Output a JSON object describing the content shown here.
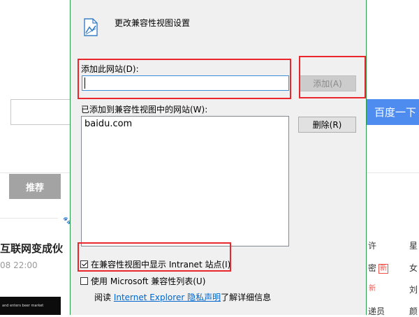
{
  "background_page": {
    "search_button_label": "百度一下",
    "tab_label": "推荐",
    "news_title": "互联网变成伙",
    "news_time": "08 22:00",
    "thumbnail_text": "and enters beer market",
    "hot_list": [
      {
        "text": "许",
        "badge": ""
      },
      {
        "text": "星",
        "badge": ""
      },
      {
        "text": "密",
        "badge": "新"
      },
      {
        "text": "女",
        "badge": ""
      },
      {
        "text": "",
        "badge": "新"
      },
      {
        "text": "刘",
        "badge": ""
      },
      {
        "text": "递员",
        "badge": ""
      },
      {
        "text": "颜",
        "badge": ""
      }
    ]
  },
  "dialog": {
    "title": "更改兼容性视图设置",
    "add_site_label": "添加此网站(D):",
    "add_site_value": "",
    "add_button_label": "添加(A)",
    "added_sites_label": "已添加到兼容性视图中的网站(W):",
    "added_sites": [
      "baidu.com"
    ],
    "remove_button_label": "删除(R)",
    "intranet_checkbox": {
      "label": "在兼容性视图中显示 Intranet 站点(I)",
      "checked": true
    },
    "ms_list_checkbox": {
      "label": "使用 Microsoft 兼容性列表(U)",
      "checked": false
    },
    "privacy": {
      "prefix": "阅读 ",
      "link": "Internet Explorer 隐私声明",
      "suffix": "了解详细信息"
    }
  },
  "colors": {
    "highlight": "#e8262b",
    "accent_blue": "#4e8cf0",
    "window_border": "#2c9b4e",
    "link": "#0066cc"
  }
}
